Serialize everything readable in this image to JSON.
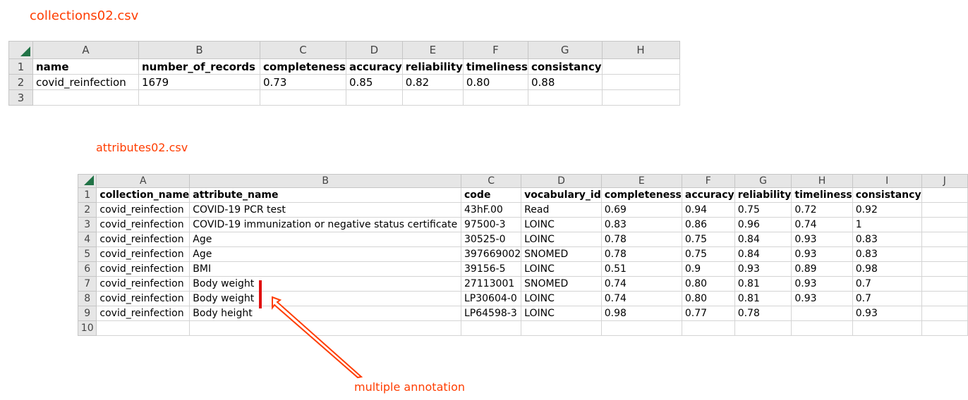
{
  "captions": {
    "file1": "collections02.csv",
    "file2": "attributes02.csv",
    "annotation": "multiple annotation"
  },
  "colors": {
    "caption": "#ff3d00",
    "marker": "#e01010",
    "excel_green": "#217346"
  },
  "sheet1": {
    "column_letters": [
      "A",
      "B",
      "C",
      "D",
      "E",
      "F",
      "G",
      "H"
    ],
    "row_numbers": [
      "1",
      "2",
      "3"
    ],
    "headers": [
      "name",
      "number_of_records",
      "completeness",
      "accuracy",
      "reliability",
      "timeliness",
      "consistancy",
      ""
    ],
    "rows": [
      [
        "covid_reinfection",
        "1679",
        "0.73",
        "0.85",
        "0.82",
        "0.80",
        "0.88",
        ""
      ],
      [
        "",
        "",
        "",
        "",
        "",
        "",
        "",
        ""
      ]
    ]
  },
  "sheet2": {
    "column_letters": [
      "A",
      "B",
      "C",
      "D",
      "E",
      "F",
      "G",
      "H",
      "I",
      "J"
    ],
    "row_numbers": [
      "1",
      "2",
      "3",
      "4",
      "5",
      "6",
      "7",
      "8",
      "9",
      "10"
    ],
    "headers": [
      "collection_name",
      "attribute_name",
      "code",
      "vocabulary_id",
      "completeness",
      "accuracy",
      "reliability",
      "timeliness",
      "consistancy",
      ""
    ],
    "rows": [
      [
        "covid_reinfection",
        "COVID-19 PCR test",
        "43hF.00",
        "Read",
        "0.69",
        "0.94",
        "0.75",
        "0.72",
        "0.92",
        ""
      ],
      [
        "covid_reinfection",
        "COVID-19 immunization or negative status certificate",
        "97500-3",
        "LOINC",
        "0.83",
        "0.86",
        "0.96",
        "0.74",
        "1",
        ""
      ],
      [
        "covid_reinfection",
        "Age",
        "30525-0",
        "LOINC",
        "0.78",
        "0.75",
        "0.84",
        "0.93",
        "0.83",
        ""
      ],
      [
        "covid_reinfection",
        "Age",
        "397669002",
        "SNOMED",
        "0.78",
        "0.75",
        "0.84",
        "0.93",
        "0.83",
        ""
      ],
      [
        "covid_reinfection",
        "BMI",
        "39156-5",
        "LOINC",
        "0.51",
        "0.9",
        "0.93",
        "0.89",
        "0.98",
        ""
      ],
      [
        "covid_reinfection",
        "Body weight",
        "27113001",
        "SNOMED",
        "0.74",
        "0.80",
        "0.81",
        "0.93",
        "0.7",
        ""
      ],
      [
        "covid_reinfection",
        "Body weight",
        "LP30604-0",
        "LOINC",
        "0.74",
        "0.80",
        "0.81",
        "0.93",
        "0.7",
        ""
      ],
      [
        "covid_reinfection",
        "Body height",
        "LP64598-3",
        "LOINC",
        "0.98",
        "0.77",
        "0.78",
        "",
        "0.93",
        ""
      ],
      [
        "",
        "",
        "",
        "",
        "",
        "",
        "",
        "",
        "",
        ""
      ]
    ]
  }
}
